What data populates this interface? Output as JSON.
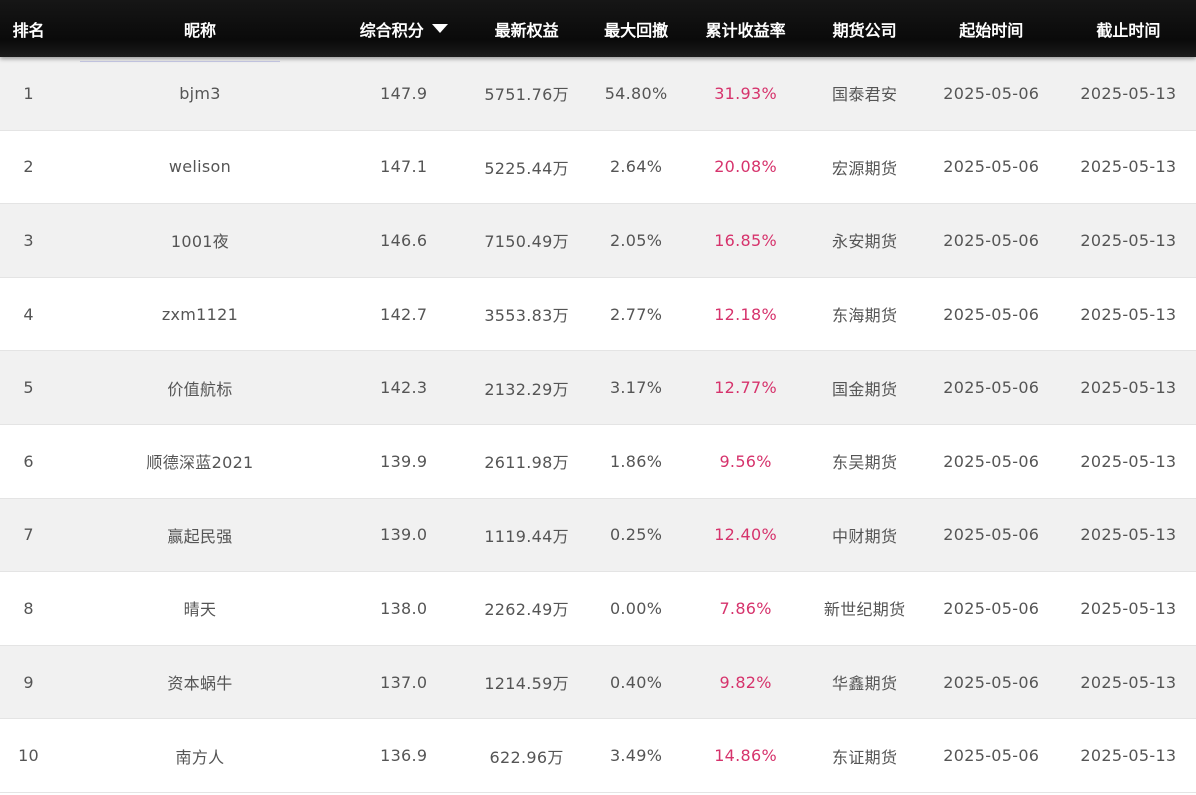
{
  "header": {
    "rank": "排名",
    "nickname": "昵称",
    "score": "综合积分",
    "equity": "最新权益",
    "drawdown": "最大回撤",
    "return_rate": "累计收益率",
    "broker": "期货公司",
    "start": "起始时间",
    "end": "截止时间"
  },
  "rows": [
    {
      "rank": "1",
      "nickname": "bjm3",
      "score": "147.9",
      "equity": "5751.76万",
      "drawdown": "54.80%",
      "return_rate": "31.93%",
      "broker": "国泰君安",
      "start": "2025-05-06",
      "end": "2025-05-13"
    },
    {
      "rank": "2",
      "nickname": "welison",
      "score": "147.1",
      "equity": "5225.44万",
      "drawdown": "2.64%",
      "return_rate": "20.08%",
      "broker": "宏源期货",
      "start": "2025-05-06",
      "end": "2025-05-13"
    },
    {
      "rank": "3",
      "nickname": "1001夜",
      "score": "146.6",
      "equity": "7150.49万",
      "drawdown": "2.05%",
      "return_rate": "16.85%",
      "broker": "永安期货",
      "start": "2025-05-06",
      "end": "2025-05-13"
    },
    {
      "rank": "4",
      "nickname": "zxm1121",
      "score": "142.7",
      "equity": "3553.83万",
      "drawdown": "2.77%",
      "return_rate": "12.18%",
      "broker": "东海期货",
      "start": "2025-05-06",
      "end": "2025-05-13"
    },
    {
      "rank": "5",
      "nickname": "价值航标",
      "score": "142.3",
      "equity": "2132.29万",
      "drawdown": "3.17%",
      "return_rate": "12.77%",
      "broker": "国金期货",
      "start": "2025-05-06",
      "end": "2025-05-13"
    },
    {
      "rank": "6",
      "nickname": "顺德深蓝2021",
      "score": "139.9",
      "equity": "2611.98万",
      "drawdown": "1.86%",
      "return_rate": "9.56%",
      "broker": "东吴期货",
      "start": "2025-05-06",
      "end": "2025-05-13"
    },
    {
      "rank": "7",
      "nickname": "赢起民强",
      "score": "139.0",
      "equity": "1119.44万",
      "drawdown": "0.25%",
      "return_rate": "12.40%",
      "broker": "中财期货",
      "start": "2025-05-06",
      "end": "2025-05-13"
    },
    {
      "rank": "8",
      "nickname": "晴天",
      "score": "138.0",
      "equity": "2262.49万",
      "drawdown": "0.00%",
      "return_rate": "7.86%",
      "broker": "新世纪期货",
      "start": "2025-05-06",
      "end": "2025-05-13"
    },
    {
      "rank": "9",
      "nickname": "资本蜗牛",
      "score": "137.0",
      "equity": "1214.59万",
      "drawdown": "0.40%",
      "return_rate": "9.82%",
      "broker": "华鑫期货",
      "start": "2025-05-06",
      "end": "2025-05-13"
    },
    {
      "rank": "10",
      "nickname": "南方人",
      "score": "136.9",
      "equity": "622.96万",
      "drawdown": "3.49%",
      "return_rate": "14.86%",
      "broker": "东证期货",
      "start": "2025-05-06",
      "end": "2025-05-13"
    }
  ],
  "sort": {
    "column": "score",
    "direction": "desc",
    "icon": "caret-down-icon"
  },
  "colors": {
    "header_bg": "#111111",
    "return_rate": "#d6336c",
    "odd_row": "#f1f1f1",
    "even_row": "#ffffff"
  }
}
